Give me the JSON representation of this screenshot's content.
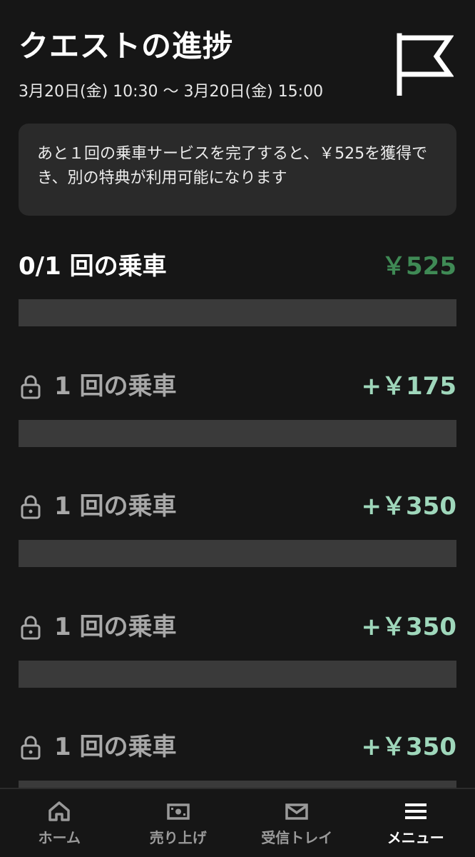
{
  "header": {
    "title": "クエストの進捗",
    "date_range": "3月20日(金) 10:30 〜 3月20日(金) 15:00",
    "icon": "flag-icon"
  },
  "info": {
    "message": "あと１回の乗車サービスを完了すると、￥525を獲得でき、別の特典が利用可能になります"
  },
  "progress": {
    "label": "0/1 回の乗車",
    "amount": "￥525",
    "fraction": 0
  },
  "tiers": [
    {
      "label": "1 回の乗車",
      "amount": "+￥175",
      "icon": "lock-icon",
      "fraction": 0
    },
    {
      "label": "1 回の乗車",
      "amount": "+￥350",
      "icon": "lock-icon",
      "fraction": 0
    },
    {
      "label": "1 回の乗車",
      "amount": "+￥350",
      "icon": "lock-icon",
      "fraction": 0
    },
    {
      "label": "1 回の乗車",
      "amount": "+￥350",
      "icon": "lock-icon",
      "fraction": 0
    }
  ],
  "nav": {
    "items": [
      {
        "label": "ホーム",
        "icon": "home-icon"
      },
      {
        "label": "売り上げ",
        "icon": "earnings-icon"
      },
      {
        "label": "受信トレイ",
        "icon": "mail-icon"
      },
      {
        "label": "メニュー",
        "icon": "menu-icon",
        "active": true
      }
    ]
  },
  "colors": {
    "background": "#161616",
    "card": "#2a2a2a",
    "bar": "#3a3a3a",
    "accent_green": "#3f8a55",
    "bonus_green": "#9fd7bb",
    "muted_text": "#a8a8a8"
  }
}
